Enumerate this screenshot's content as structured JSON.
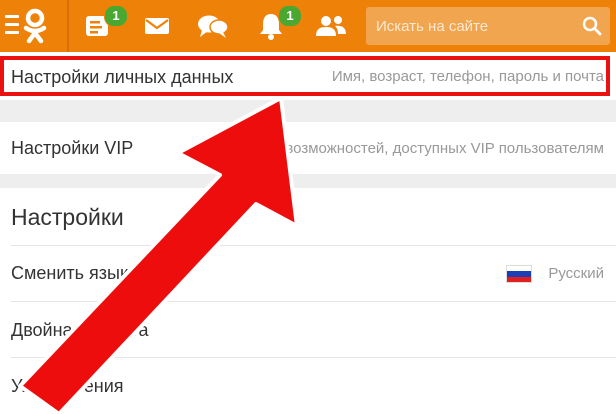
{
  "header": {
    "nav": [
      {
        "name": "notes",
        "badge": "1"
      },
      {
        "name": "messages"
      },
      {
        "name": "discussions"
      },
      {
        "name": "notifications",
        "badge": "1"
      },
      {
        "name": "friends"
      }
    ],
    "search": {
      "placeholder": "Искать на сайте"
    }
  },
  "settings": {
    "personal": {
      "title": "Настройки личных данных",
      "desc": "Имя, возраст, телефон, пароль и почта"
    },
    "vip": {
      "title": "Настройки VIP",
      "desc": "Настройка возможностей, доступных VIP пользователям"
    },
    "section_title": "Настройки",
    "items": [
      {
        "label": "Сменить язык",
        "value": "Русский"
      },
      {
        "label": "Двойная защита"
      },
      {
        "label": "Уведомления"
      }
    ]
  },
  "colors": {
    "accent": "#ee8208",
    "badge": "#4aa832",
    "highlight": "#ec1111"
  }
}
